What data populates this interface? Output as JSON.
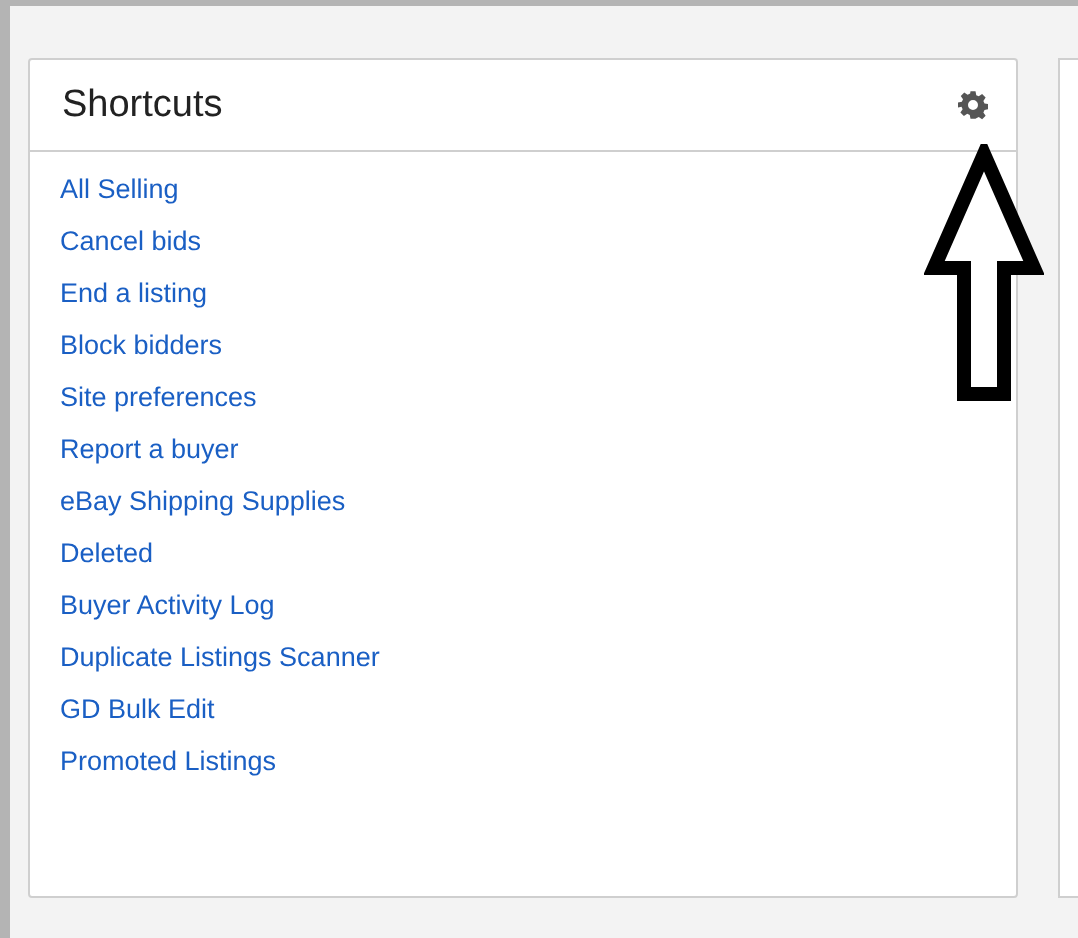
{
  "card": {
    "title": "Shortcuts",
    "links": [
      "All Selling",
      "Cancel bids",
      "End a listing",
      "Block bidders",
      "Site preferences",
      "Report a buyer",
      "eBay Shipping Supplies",
      "Deleted",
      "Buyer Activity Log",
      "Duplicate Listings Scanner",
      "GD Bulk Edit",
      "Promoted Listings"
    ]
  }
}
